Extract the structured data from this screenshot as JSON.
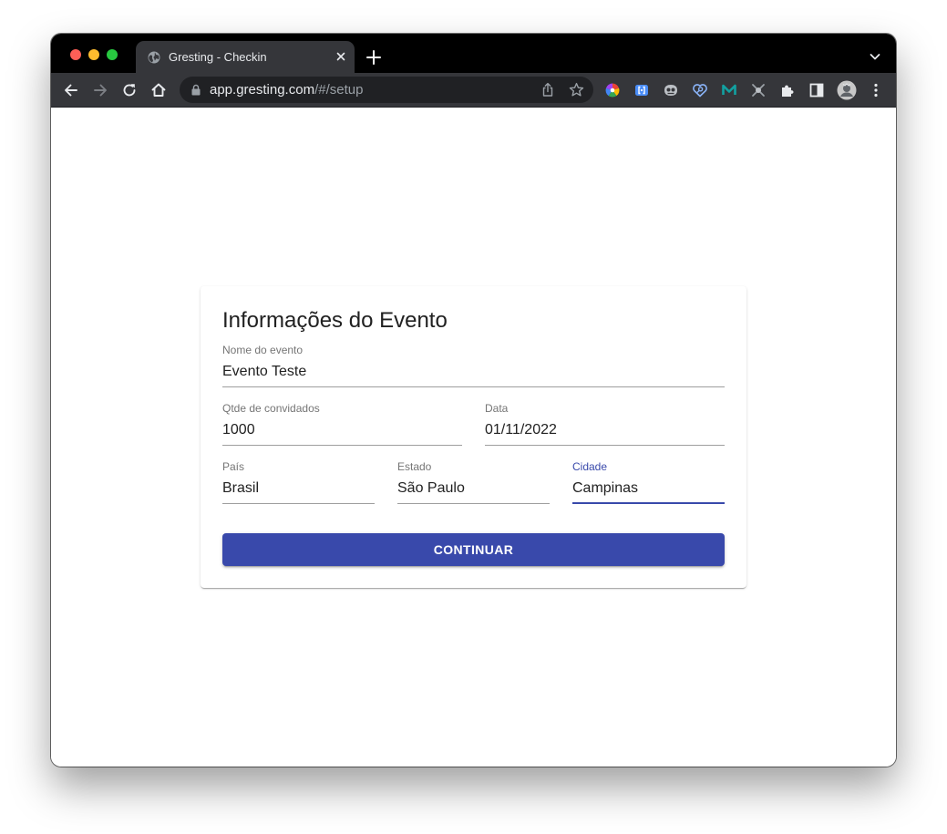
{
  "browser": {
    "tab": {
      "title": "Gresting - Checkin"
    },
    "address": {
      "host": "app.gresting.com",
      "path": "/#/setup"
    },
    "extensions": [
      "color-picker-extension-icon",
      "bracket-extension-icon",
      "tracker-extension-icon",
      "password-manager-extension-icon",
      "m-logo-extension-icon",
      "crossed-extension-icon",
      "puzzle-icon",
      "side-panel-icon",
      "profile-avatar",
      "kebab-menu-icon"
    ]
  },
  "form": {
    "title": "Informações do Evento",
    "fields": {
      "event_name": {
        "label": "Nome do evento",
        "value": "Evento Teste"
      },
      "guests": {
        "label": "Qtde de convidados",
        "value": "1000"
      },
      "date": {
        "label": "Data",
        "value": "01/11/2022"
      },
      "country": {
        "label": "País",
        "value": "Brasil"
      },
      "state": {
        "label": "Estado",
        "value": "São Paulo"
      },
      "city": {
        "label": "Cidade",
        "value": "Campinas",
        "focused": true
      }
    },
    "submit_label": "CONTINUAR"
  },
  "colors": {
    "primary": "#3949ab",
    "tab_strip": "#000000",
    "toolbar": "#35363a",
    "text": "#212121",
    "label": "#757575"
  }
}
